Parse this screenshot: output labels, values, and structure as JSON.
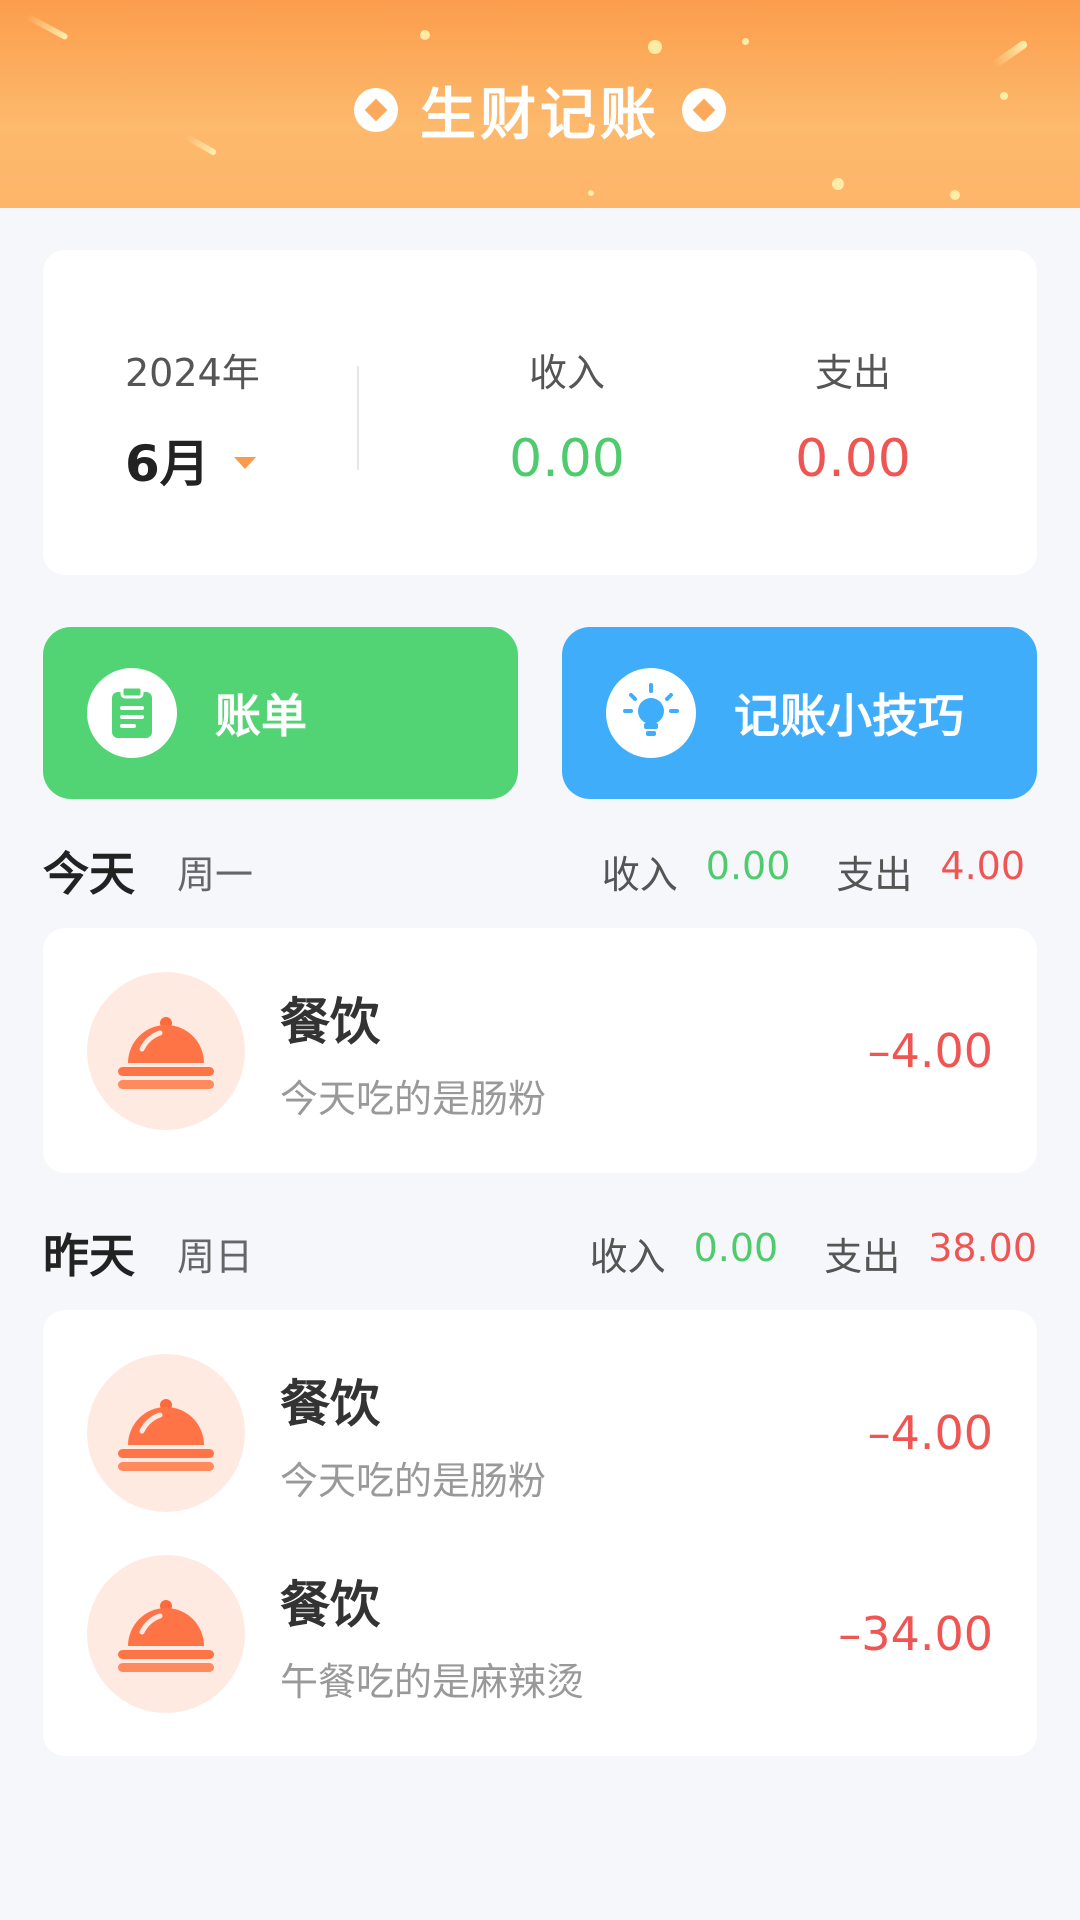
{
  "header": {
    "title": "生财记账",
    "colors": {
      "gradient_top": "#fb9d4c",
      "gradient_bottom": "#fdb56a"
    },
    "icons": [
      "diamond-icon",
      "diamond-icon"
    ]
  },
  "summary": {
    "year": "2024年",
    "month": "6月",
    "income_label": "收入",
    "income_value": "0.00",
    "expense_label": "支出",
    "expense_value": "0.00"
  },
  "actions": {
    "bill": {
      "label": "账单",
      "icon": "clipboard-icon",
      "color": "#52d475"
    },
    "tips": {
      "label": "记账小技巧",
      "icon": "lightbulb-icon",
      "color": "#40adfb"
    }
  },
  "groups": [
    {
      "day": "今天",
      "weekday": "周一",
      "income_label": "收入",
      "income_value": "0.00",
      "expense_label": "支出",
      "expense_value": "4.00",
      "records": [
        {
          "category": "餐饮",
          "note": "今天吃的是肠粉",
          "amount": "–4.00",
          "icon": "food-cloche-icon"
        }
      ]
    },
    {
      "day": "昨天",
      "weekday": "周日",
      "income_label": "收入",
      "income_value": "0.00",
      "expense_label": "支出",
      "expense_value": "38.00",
      "records": [
        {
          "category": "餐饮",
          "note": "今天吃的是肠粉",
          "amount": "–4.00",
          "icon": "food-cloche-icon"
        },
        {
          "category": "餐饮",
          "note": "午餐吃的是麻辣烫",
          "amount": "–34.00",
          "icon": "food-cloche-icon"
        }
      ]
    }
  ],
  "colors": {
    "income": "#4ecb6c",
    "expense": "#ef5553",
    "background": "#f6f7fb"
  }
}
